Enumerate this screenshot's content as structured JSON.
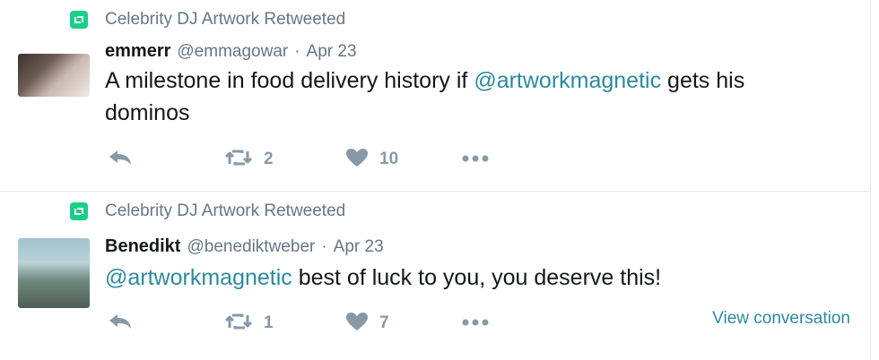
{
  "tweets": [
    {
      "retweet_context": "Celebrity DJ Artwork Retweeted",
      "name": "emmerr",
      "handle": "@emmagowar",
      "separator": "·",
      "date": "Apr 23",
      "text_before": "A milestone in food delivery history if ",
      "mention": "@artworkmagnetic",
      "text_after": " gets his dominos",
      "retweet_count": "2",
      "like_count": "10"
    },
    {
      "retweet_context": "Celebrity DJ Artwork Retweeted",
      "name": "Benedikt",
      "handle": "@benediktweber",
      "separator": "·",
      "date": "Apr 23",
      "text_before": "",
      "mention": "@artworkmagnetic",
      "text_after": " best of luck to you, you deserve this!",
      "retweet_count": "1",
      "like_count": "7",
      "view_conversation": "View conversation"
    }
  ],
  "icons": {
    "retweet_context": "retweet-icon",
    "reply": "reply-icon",
    "retweet": "retweet-icon",
    "like": "heart-icon",
    "more": "more-icon"
  },
  "colors": {
    "accent": "#2d8a9e",
    "retweet_badge": "#19cf86",
    "muted": "#657786",
    "action": "#8899a6"
  }
}
